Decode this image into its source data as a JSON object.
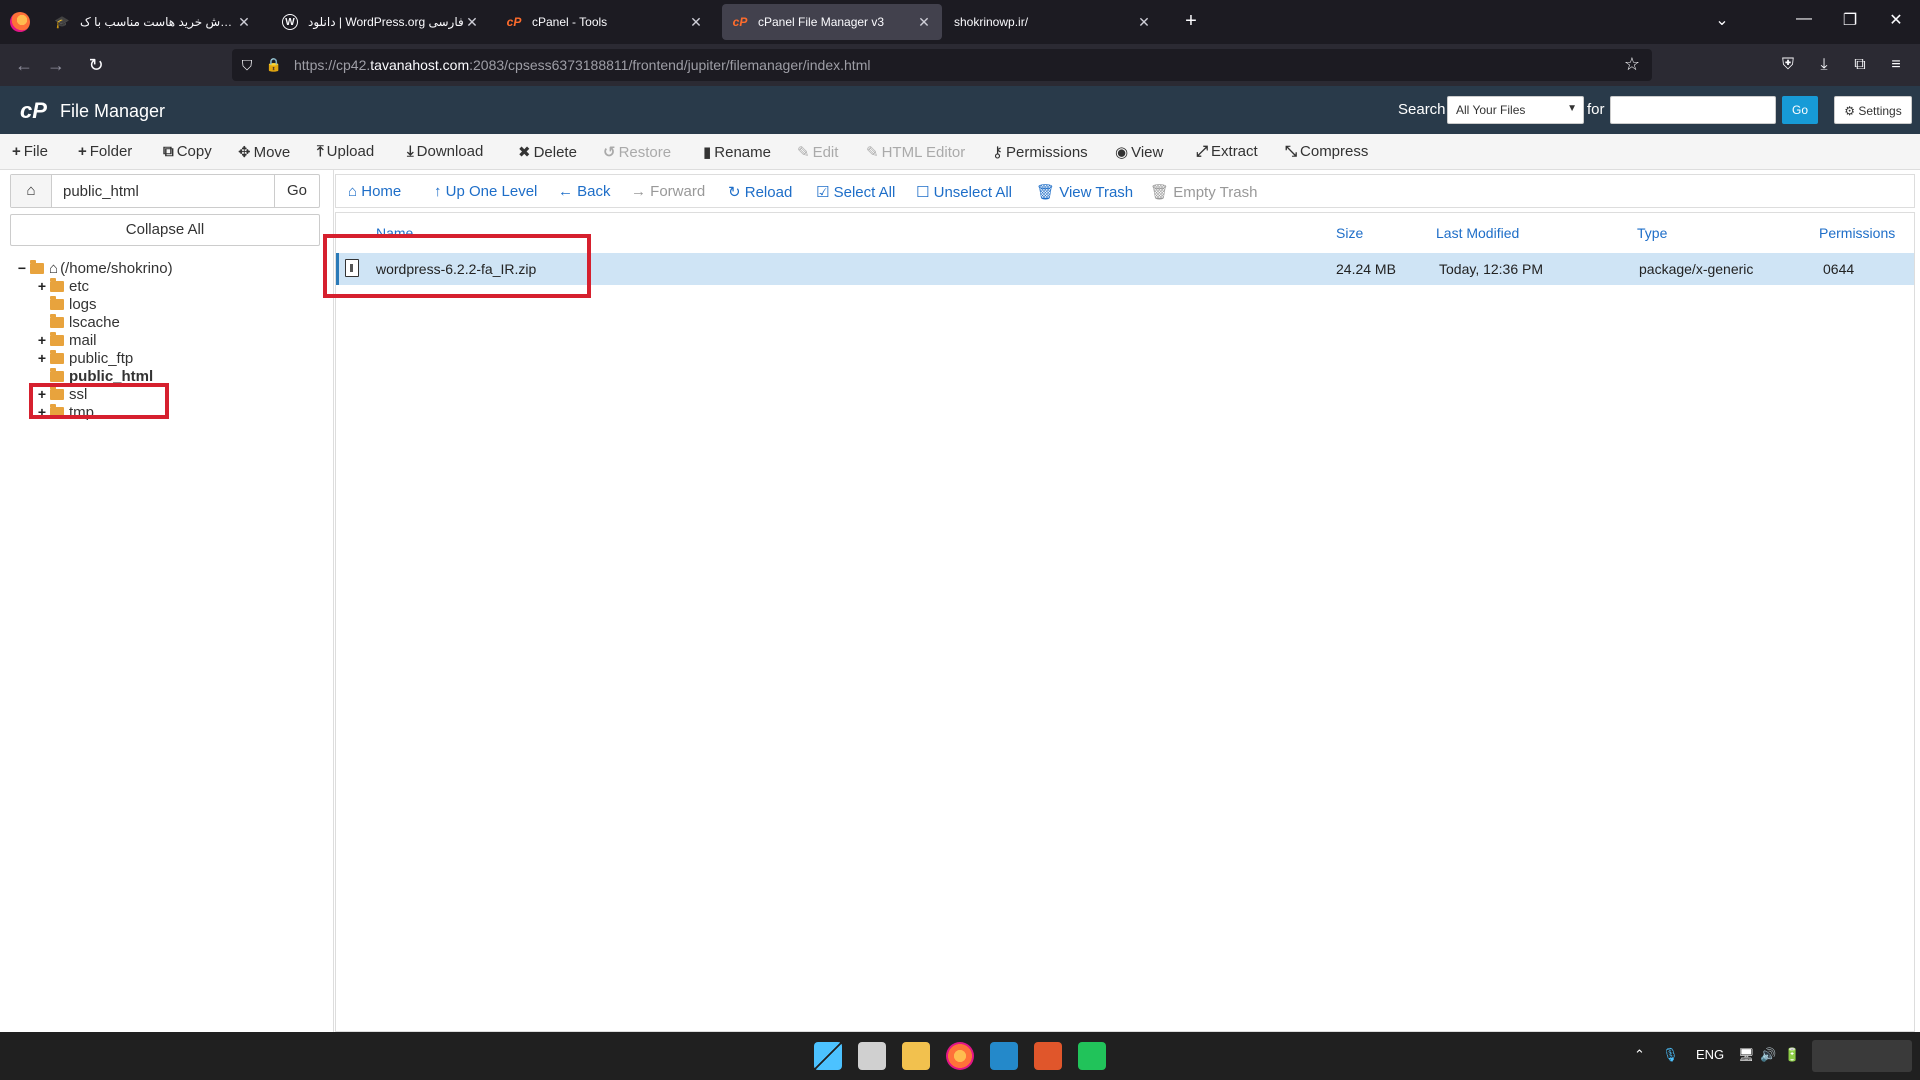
{
  "browser": {
    "tabs": [
      {
        "title": "آموزش خرید هاست مناسب با ک...",
        "icon": "graduation-cap-icon"
      },
      {
        "title": "دانلود | WordPress.org فارسی",
        "icon": "wordpress-icon"
      },
      {
        "title": "cPanel - Tools",
        "icon": "cpanel-icon"
      },
      {
        "title": "cPanel File Manager v3",
        "icon": "cpanel-icon"
      },
      {
        "title": "shokrinowp.ir/",
        "icon": ""
      }
    ],
    "url_prefix": "https://cp42.",
    "url_domain": "tavanahost.com",
    "url_rest": ":2083/cpsess6373188811/frontend/jupiter/filemanager/index.html"
  },
  "header": {
    "logo": "cP",
    "title": "File Manager",
    "search_label": "Search",
    "search_scope": "All Your Files",
    "for_label": "for",
    "go_label": "Go",
    "settings_label": "Settings"
  },
  "toolbar": {
    "file": "File",
    "folder": "Folder",
    "copy": "Copy",
    "move": "Move",
    "upload": "Upload",
    "download": "Download",
    "delete": "Delete",
    "restore": "Restore",
    "rename": "Rename",
    "edit": "Edit",
    "html_editor": "HTML Editor",
    "permissions": "Permissions",
    "view": "View",
    "extract": "Extract",
    "compress": "Compress"
  },
  "left": {
    "path": "public_html",
    "go_label": "Go",
    "collapse_label": "Collapse All",
    "root": "(/home/shokrino)",
    "folders": [
      "etc",
      "logs",
      "lscache",
      "mail",
      "public_ftp",
      "public_html",
      "ssl",
      "tmp"
    ]
  },
  "nav": {
    "home": "Home",
    "up": "Up One Level",
    "back": "Back",
    "forward": "Forward",
    "reload": "Reload",
    "select_all": "Select All",
    "unselect_all": "Unselect All",
    "view_trash": "View Trash",
    "empty_trash": "Empty Trash"
  },
  "table": {
    "headers": {
      "name": "Name",
      "size": "Size",
      "modified": "Last Modified",
      "type": "Type",
      "perms": "Permissions"
    },
    "rows": [
      {
        "name": "wordpress-6.2.2-fa_IR.zip",
        "size": "24.24 MB",
        "modified": "Today, 12:36 PM",
        "type": "package/x-generic",
        "perms": "0644"
      }
    ]
  },
  "taskbar": {
    "lang": "ENG"
  },
  "colors": {
    "cp_header": "#293a4a",
    "link_blue": "#1e6ec8",
    "selected_row": "#cfe4f5",
    "annotation_red": "#d6202e"
  }
}
